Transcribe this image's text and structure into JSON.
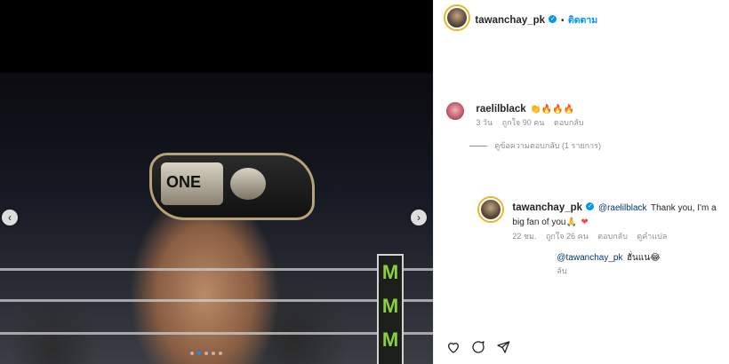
{
  "post": {
    "author": "tawanchay_pk",
    "follow_label": "ติดตาม",
    "photo_alt_brand": "ONE",
    "photo_banner": "M"
  },
  "comments": [
    {
      "username": "raelilblack",
      "text": "👏🔥🔥🔥",
      "time": "3 วัน",
      "likes": "ถูกใจ 90 คน",
      "reply": "ตอบกลับ"
    }
  ],
  "view_replies": "ดูข้อความตอบกลับ (1 รายการ)",
  "reply": {
    "username": "tawanchay_pk",
    "mention": "@raelilblack",
    "text": "Thank you, I'm a big fan of you🙏",
    "heart": "❤",
    "time": "22 ชม.",
    "likes": "ถูกใจ 26 คน",
    "reply": "ตอบกลับ",
    "translate": "ดูคำแปล"
  },
  "draft": {
    "mention": "@tawanchay_pk",
    "text": "ฮั่นแน😂",
    "subtext": "ลับ"
  },
  "colors": {
    "accent": "#0095f6",
    "meta": "#8e8e8e",
    "like": "#ed4956"
  },
  "icons": [
    "heart-outline-icon",
    "comment-icon",
    "share-icon"
  ]
}
